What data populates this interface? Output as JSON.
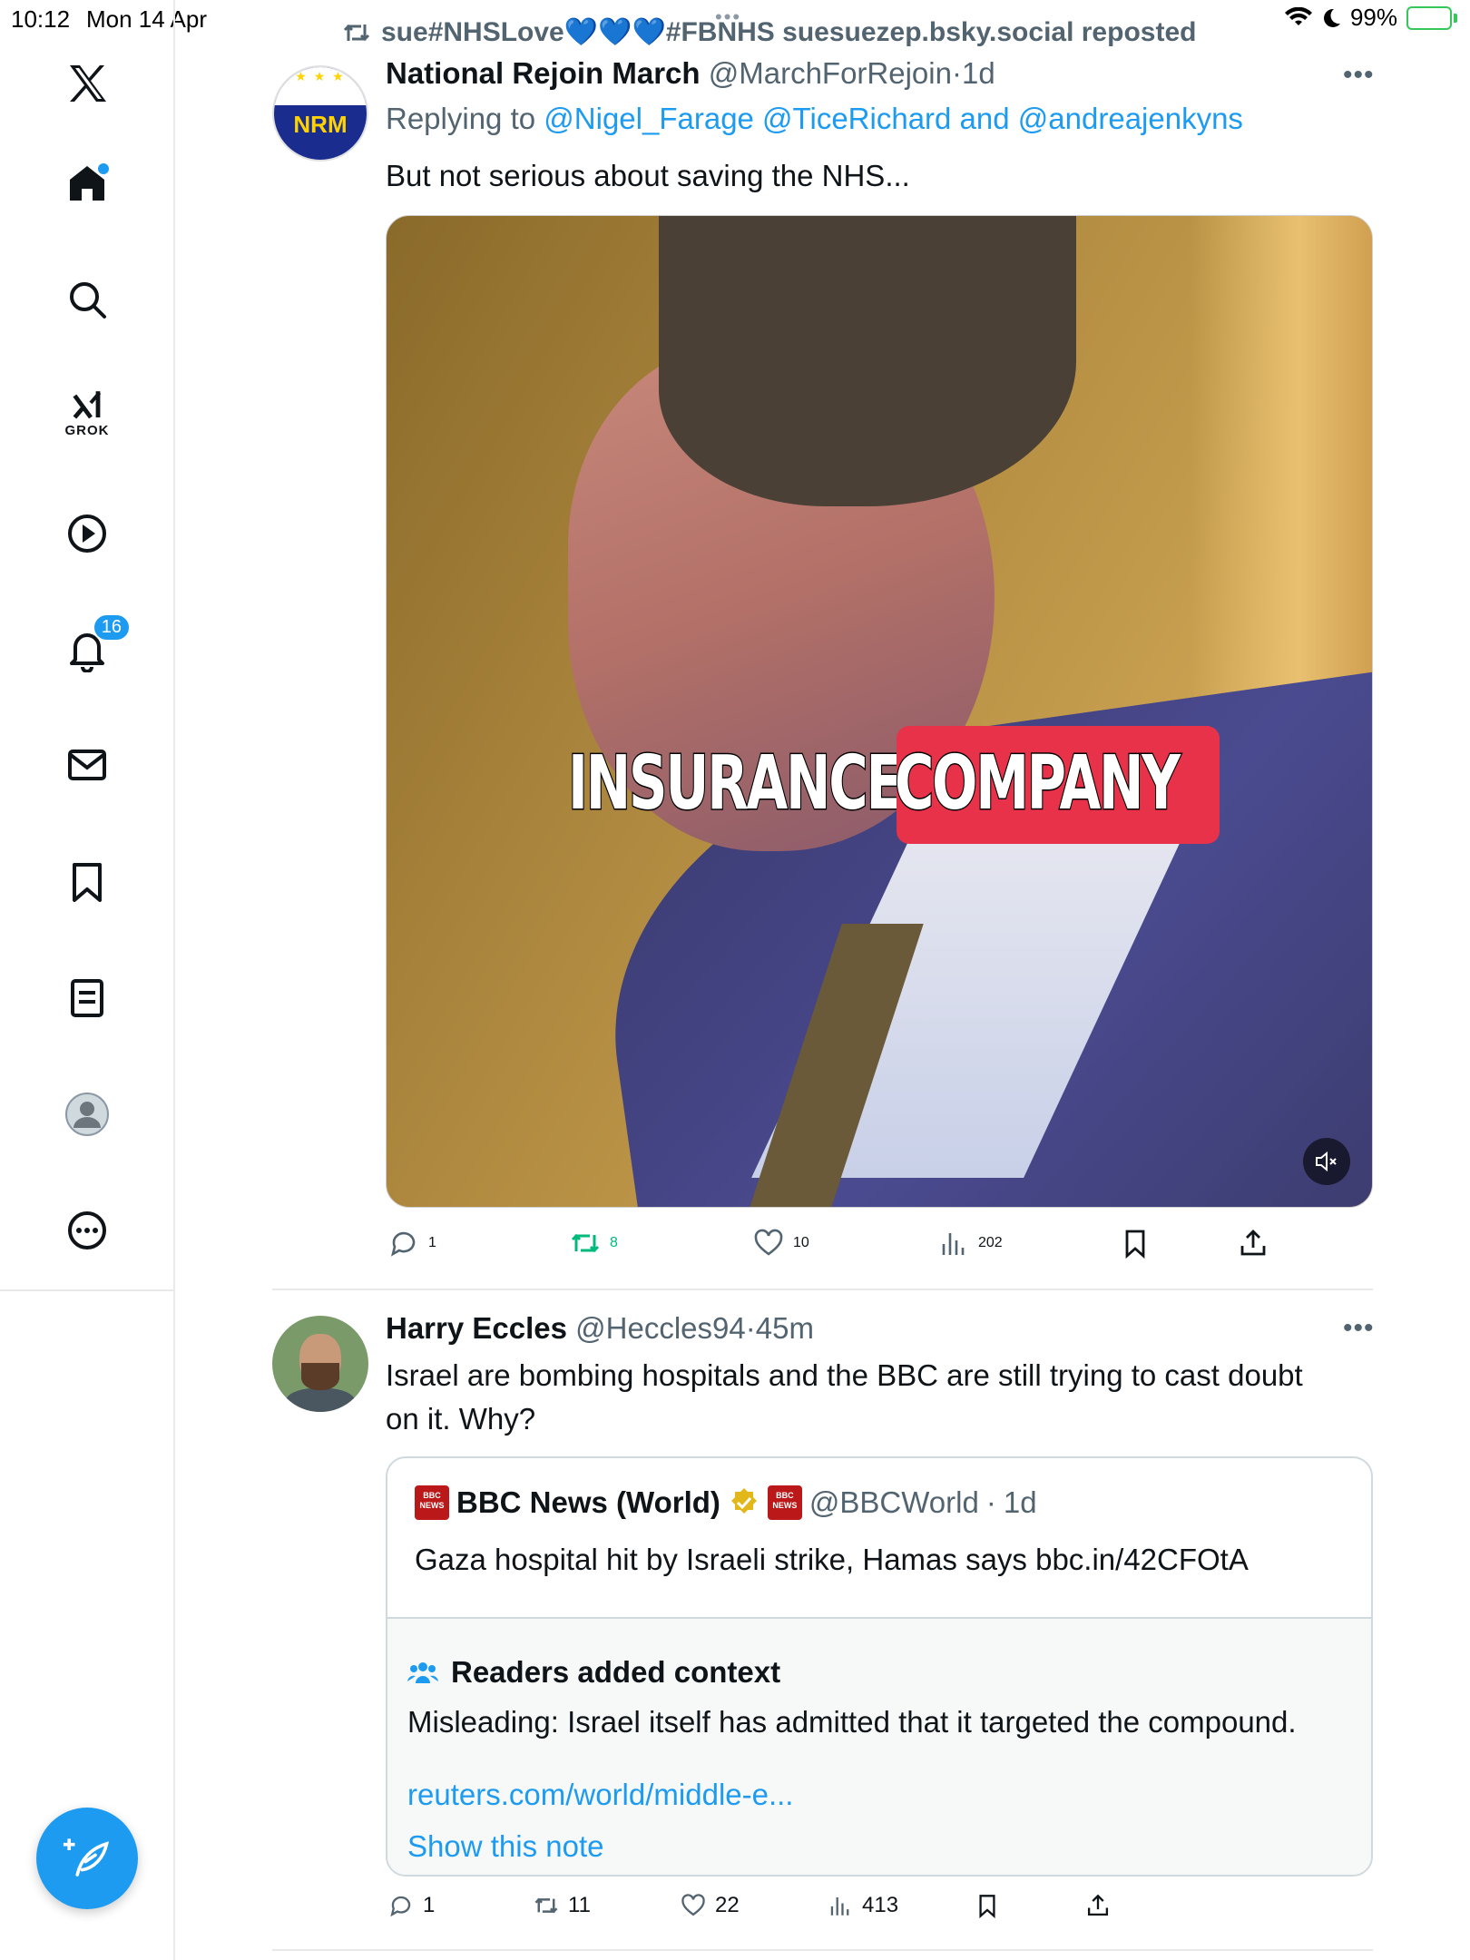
{
  "status_bar": {
    "time": "10:12",
    "date": "Mon 14 Apr",
    "battery": "99%",
    "battery_level": 0.99
  },
  "sidebar": {
    "items": [
      {
        "name": "home",
        "icon": "home-icon"
      },
      {
        "name": "explore",
        "icon": "search-icon"
      },
      {
        "name": "grok",
        "icon": "grok-icon",
        "label": "GROK"
      },
      {
        "name": "videos",
        "icon": "play-icon"
      },
      {
        "name": "notifications",
        "icon": "bell-icon",
        "badge": "16"
      },
      {
        "name": "messages",
        "icon": "mail-icon"
      },
      {
        "name": "bookmarks",
        "icon": "bookmark-icon"
      },
      {
        "name": "lists",
        "icon": "list-icon"
      },
      {
        "name": "profile",
        "icon": "profile-icon"
      },
      {
        "name": "more",
        "icon": "more-icon"
      }
    ],
    "compose_icon": "compose-icon"
  },
  "tweet1": {
    "repost_text": "sue#NHSLove💙💙💙#FBNHS suesuezep.bsky.social reposted",
    "avatar_text": "NRM",
    "display_name": "National Rejoin March",
    "handle": "@MarchForRejoin",
    "sep": "·",
    "time": "1d",
    "replying_label": "Replying to",
    "reply_handles": "@Nigel_Farage @TiceRichard and @andreajenkyns",
    "text": "But not serious about saving the NHS...",
    "video_caption_1": "INSURANCE",
    "video_caption_2": "COMPANY",
    "replies": "1",
    "reposts": "8",
    "likes": "10",
    "views": "202"
  },
  "tweet2": {
    "display_name": "Harry Eccles",
    "handle": "@Heccles94",
    "sep": "·",
    "time": "45m",
    "text_line1": "Israel are bombing hospitals and the BBC are still trying to cast doubt",
    "text_line2": "on it. Why?",
    "quote": {
      "display_name": "BBC News (World)",
      "handle": "@BBCWorld",
      "sep": "·",
      "time": "1d",
      "text": "Gaza hospital hit by Israeli strike, Hamas says bbc.in/42CFOtA"
    },
    "context": {
      "title": "Readers added context",
      "body": "Misleading: Israel itself has admitted that it targeted the compound.",
      "link": "reuters.com/world/middle-e...",
      "show": "Show this note"
    },
    "replies": "1",
    "reposts": "11",
    "likes": "22",
    "views": "413"
  },
  "colors": {
    "accent": "#1d9bf0",
    "repost_green": "#00ba7c",
    "muted_text": "#536471",
    "caption_red": "#e8324a"
  }
}
